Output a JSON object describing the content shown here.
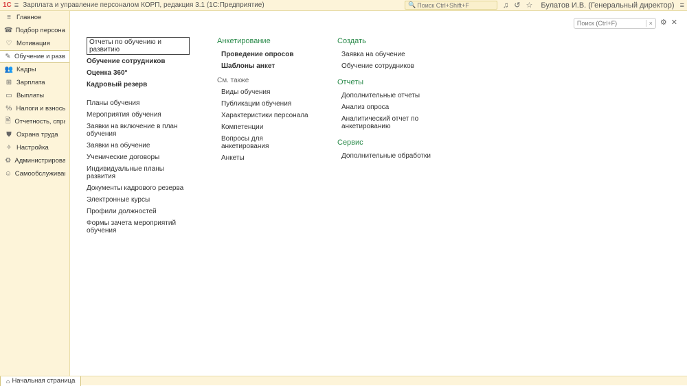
{
  "top": {
    "title": "Зарплата и управление персоналом КОРП, редакция 3.1  (1С:Предприятие)",
    "search_placeholder": "Поиск Ctrl+Shift+F",
    "user": "Булатов И.В.  (Генеральный директор)"
  },
  "sidebar": {
    "items": [
      {
        "icon": "≡",
        "label": "Главное"
      },
      {
        "icon": "☎",
        "label": "Подбор персонала"
      },
      {
        "icon": "♡",
        "label": "Мотивация"
      },
      {
        "icon": "✎",
        "label": "Обучение и развитие"
      },
      {
        "icon": "👥",
        "label": "Кадры"
      },
      {
        "icon": "⊞",
        "label": "Зарплата"
      },
      {
        "icon": "▭",
        "label": "Выплаты"
      },
      {
        "icon": "%",
        "label": "Налоги и взносы"
      },
      {
        "icon": "🖹",
        "label": "Отчетность, справки"
      },
      {
        "icon": "⛊",
        "label": "Охрана труда"
      },
      {
        "icon": "✧",
        "label": "Настройка"
      },
      {
        "icon": "⚙",
        "label": "Администрирование"
      },
      {
        "icon": "☺",
        "label": "Самообслуживание"
      }
    ]
  },
  "bottom": {
    "home_label": "Начальная страница"
  },
  "content": {
    "search_placeholder": "Поиск (Ctrl+F)",
    "col1": {
      "top_links": [
        "Отчеты по обучению и развитию",
        "Обучение сотрудников",
        "Оценка 360°",
        "Кадровый резерв"
      ],
      "links": [
        "Планы обучения",
        "Мероприятия обучения",
        "Заявки на включение в план обучения",
        "Заявки на обучение",
        "Ученические договоры",
        "Индивидуальные планы развития",
        "Документы кадрового резерва",
        "Электронные курсы",
        "Профили должностей",
        "Формы зачета мероприятий обучения"
      ]
    },
    "col2": {
      "heading": "Анкетирование",
      "bold_links": [
        "Проведение опросов",
        "Шаблоны анкет"
      ],
      "subheading": "См. также",
      "links": [
        "Виды обучения",
        "Публикации обучения",
        "Характеристики персонала",
        "Компетенции",
        "Вопросы для анкетирования",
        "Анкеты"
      ]
    },
    "col3": {
      "sections": [
        {
          "heading": "Создать",
          "links": [
            "Заявка на обучение",
            "Обучение сотрудников"
          ]
        },
        {
          "heading": "Отчеты",
          "links": [
            "Дополнительные отчеты",
            "Анализ опроса",
            "Аналитический отчет по анкетированию"
          ]
        },
        {
          "heading": "Сервис",
          "links": [
            "Дополнительные обработки"
          ]
        }
      ]
    }
  }
}
